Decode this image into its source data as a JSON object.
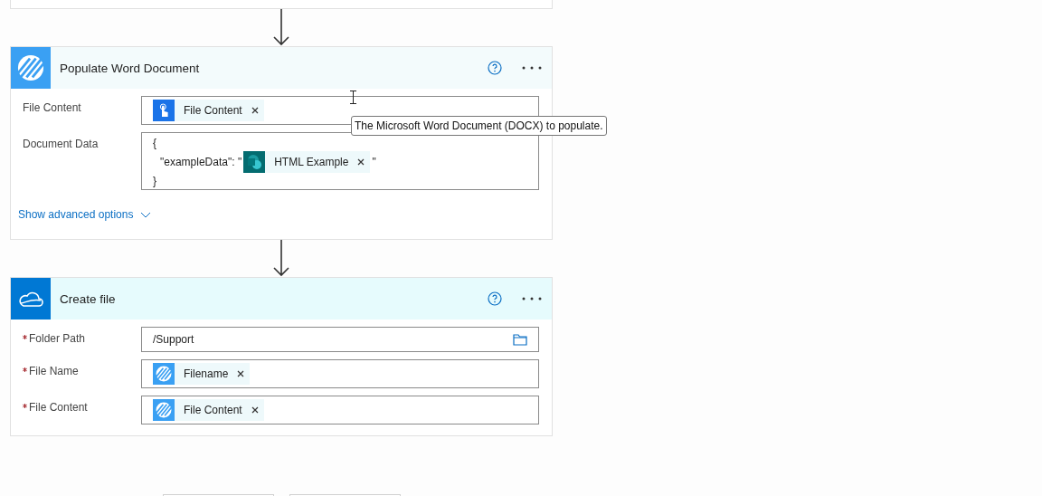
{
  "cards": [
    {
      "title": "Populate Word Document",
      "kind": "stripes",
      "highlighted": false,
      "fields": [
        {
          "label": "File Content",
          "required": false,
          "kind": "tokens",
          "tokens": [
            {
              "label": "File Content",
              "kind": "touch"
            }
          ]
        },
        {
          "label": "Document Data",
          "required": false,
          "kind": "json",
          "lines": [
            "{",
            "\"exampleData\": \"",
            "}"
          ],
          "tokens": [
            {
              "label": "HTML Example",
              "kind": "sharepoint"
            }
          ],
          "after": "\""
        }
      ],
      "advanced_link": "Show advanced options"
    },
    {
      "title": "Create file",
      "kind": "cloud",
      "highlighted": true,
      "fields": [
        {
          "label": "Folder Path",
          "required": true,
          "kind": "text",
          "value": "/Support"
        },
        {
          "label": "File Name",
          "required": true,
          "kind": "tokens",
          "tokens": [
            {
              "label": "Filename",
              "kind": "stripes"
            }
          ]
        },
        {
          "label": "File Content",
          "required": true,
          "kind": "tokens",
          "tokens": [
            {
              "label": "File Content",
              "kind": "stripes"
            }
          ]
        }
      ]
    }
  ],
  "tooltip": "The Microsoft Word Document (DOCX) to populate."
}
